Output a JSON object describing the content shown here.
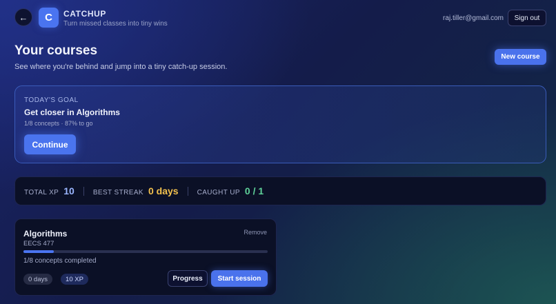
{
  "header": {
    "back_icon": "arrow-left-icon",
    "logo_letter": "C",
    "brand_name": "CATCHUP",
    "tagline": "Turn missed classes into tiny wins",
    "user_email": "raj.tiller@gmail.com",
    "signout_label": "Sign out"
  },
  "page": {
    "title": "Your courses",
    "subtitle": "See where you're behind and jump into a tiny catch-up session.",
    "new_course_label": "New course"
  },
  "goal": {
    "label": "TODAY'S GOAL",
    "title": "Get closer in Algorithms",
    "meta": "1/8 concepts · 87% to go",
    "continue_label": "Continue"
  },
  "stats": {
    "total_xp_label": "TOTAL XP",
    "total_xp_value": "10",
    "best_streak_label": "BEST STREAK",
    "best_streak_value": "0 days",
    "caught_up_label": "CAUGHT UP",
    "caught_up_value": "0 / 1"
  },
  "courses": [
    {
      "name": "Algorithms",
      "code": "EECS 477",
      "remove_label": "Remove",
      "progress_fraction": 0.125,
      "progress_text": "1/8 concepts completed",
      "days_pill": "0 days",
      "xp_pill": "10 XP",
      "progress_label": "Progress",
      "start_label": "Start session"
    }
  ],
  "colors": {
    "accent": "#4a74f0",
    "streak": "#f2c14e",
    "caught_up": "#5fd39a"
  }
}
